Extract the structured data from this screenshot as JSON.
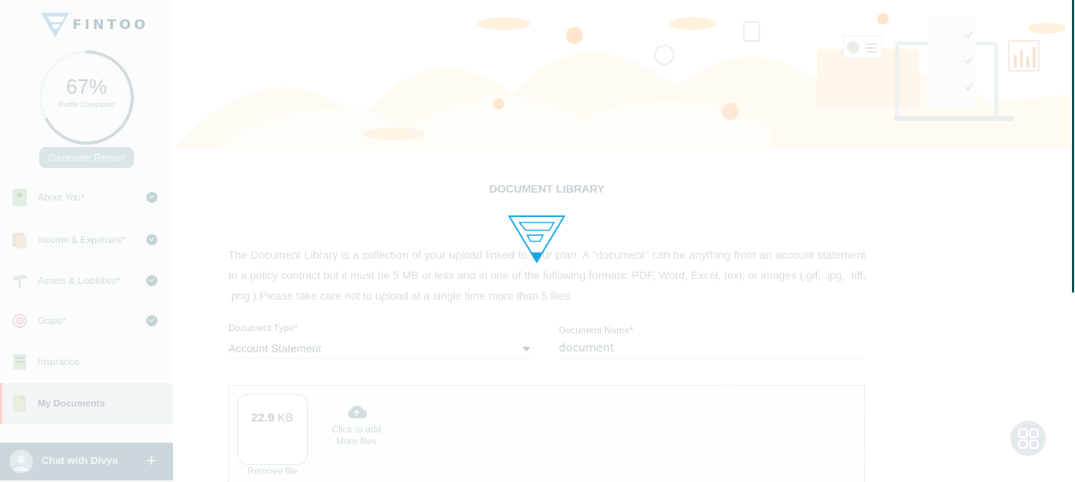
{
  "brand": {
    "name": "FINTOO"
  },
  "profile": {
    "percent": "67%",
    "label": "Profile Completed",
    "completion": 0.67
  },
  "generate_report": "Generate Report",
  "nav": [
    {
      "label": "About You*",
      "icon": "user-doc-icon",
      "done": true
    },
    {
      "label": "Income & Expenses*",
      "icon": "money-icon",
      "done": true
    },
    {
      "label": "Assets & Liabilities*",
      "icon": "plant-icon",
      "done": true
    },
    {
      "label": "Goals*",
      "icon": "target-icon",
      "done": true
    },
    {
      "label": "Insurance",
      "icon": "insurance-icon",
      "done": false
    },
    {
      "label": "My Documents",
      "icon": "document-icon",
      "done": false,
      "active": true
    }
  ],
  "chat": {
    "label": "Chat with Divya"
  },
  "page": {
    "title": "DOCUMENT LIBRARY",
    "description": "The Document Library is a collection of your upload linked to your plan. A \"document\" can be anything from an account statement to a policy contract but it must be 5 MB or less and in one of the following formats: PDF, Word, Excel, text, or images (.gif, .jpg, .tiff, .png ).Please take care not to upload at a single time more than 5 files."
  },
  "form": {
    "doc_type_label": "Document Type*",
    "doc_type_value": "Account Statement",
    "doc_name_label": "Document Name*",
    "doc_name_value": "document"
  },
  "upload": {
    "file_size_num": "22.9",
    "file_size_unit": "KB",
    "remove_label": "Remove file",
    "add_label_1": "Click to add",
    "add_label_2": "More files"
  },
  "colors": {
    "accent": "#0e4a4a",
    "loader": "#1aa6e0"
  }
}
